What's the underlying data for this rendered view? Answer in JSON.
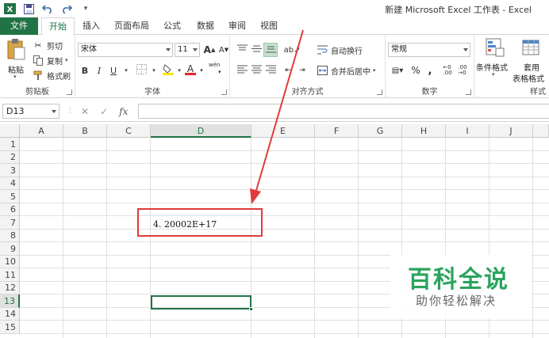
{
  "window": {
    "title": "新建 Microsoft Excel 工作表 - Excel"
  },
  "qat": {
    "icons": [
      "excel-logo-icon",
      "save-icon",
      "undo-icon",
      "redo-icon",
      "customize-icon"
    ],
    "more": "▾"
  },
  "tabs": {
    "file": "文件",
    "home": "开始",
    "insert": "插入",
    "page_layout": "页面布局",
    "formulas": "公式",
    "data": "数据",
    "review": "审阅",
    "view": "视图"
  },
  "clipboard": {
    "label": "剪贴板",
    "paste": "粘贴",
    "cut": "剪切",
    "copy": "复制",
    "format_painter": "格式刷"
  },
  "font": {
    "label": "字体",
    "name": "宋体",
    "size": "11",
    "bold": "B",
    "italic": "I",
    "underline": "U",
    "grow": "A",
    "shrink": "A",
    "phonetic": "wén"
  },
  "alignment": {
    "label": "对齐方式",
    "wrap_text": "自动换行",
    "merge_center": "合并后居中"
  },
  "number": {
    "label": "数字",
    "format": "常规",
    "percent": "%",
    "comma": ","
  },
  "styles": {
    "label": "样式",
    "conditional": "条件格式",
    "table_line1": "套用",
    "table_line2": "表格格式"
  },
  "formula_bar": {
    "name_box": "D13",
    "fx": "fx",
    "value": ""
  },
  "grid": {
    "columns": [
      "A",
      "B",
      "C",
      "D",
      "E",
      "F",
      "G",
      "H",
      "I",
      "J"
    ],
    "rows": [
      "1",
      "2",
      "3",
      "4",
      "5",
      "6",
      "7",
      "8",
      "9",
      "10",
      "11",
      "12",
      "13",
      "14",
      "15"
    ],
    "selected_column": "D",
    "selected_row": "13",
    "cell_d7": "4. 20002E+17"
  },
  "watermark": {
    "title": "百科全说",
    "subtitle": "助你轻松解决"
  },
  "colors": {
    "accent": "#217346",
    "annotation": "#e03b3b",
    "watermark": "#2aa45e"
  }
}
